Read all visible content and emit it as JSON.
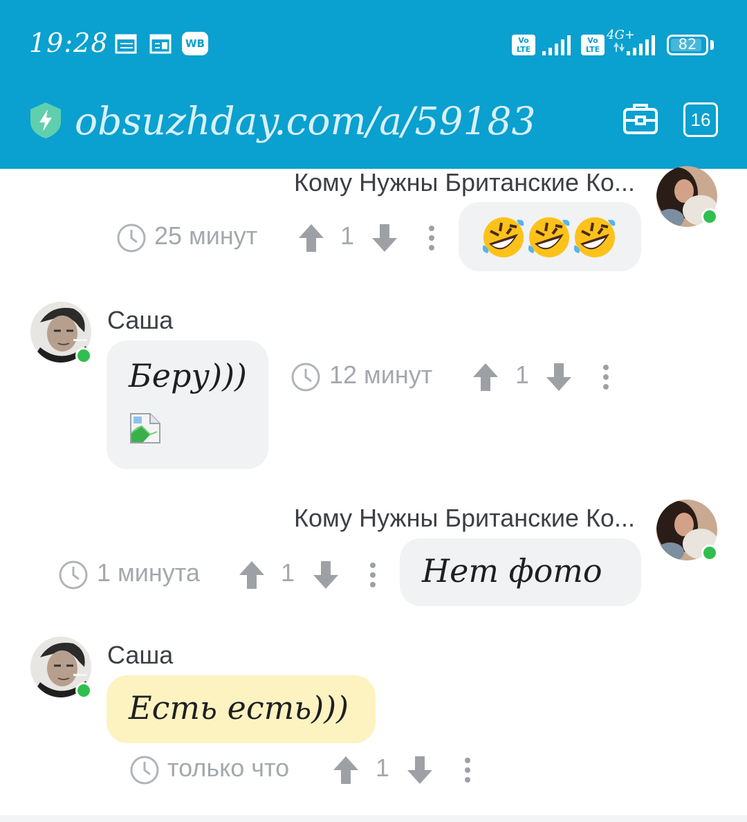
{
  "status_bar": {
    "time": "19:28",
    "badge": "WB",
    "lte_label_1": "Vo LTE",
    "lte_label_2": "Vo LTE",
    "network": "4G+",
    "battery": "82"
  },
  "browser": {
    "url": "obsuzhday.com/a/59183",
    "tab_count": "16"
  },
  "messages": [
    {
      "author": "Кому Нужны Британские Ко...",
      "text": "🤣🤣🤣",
      "time": "25 минут",
      "votes": "1",
      "side": "right"
    },
    {
      "author": "Саша",
      "text": "Беру)))",
      "time": "12 минут",
      "votes": "1",
      "side": "left"
    },
    {
      "author": "Кому Нужны Британские Ко...",
      "text": "Нет фото",
      "time": "1 минута",
      "votes": "1",
      "side": "right"
    },
    {
      "author": "Саша",
      "text": "Есть есть)))",
      "time": "только что",
      "votes": "1",
      "side": "left"
    }
  ],
  "colors": {
    "header": "#0aa0cf",
    "bubble": "#f1f2f4",
    "highlight_bubble": "#fdf3c1",
    "online": "#2fbf4e",
    "meta": "#a4a8ad"
  }
}
